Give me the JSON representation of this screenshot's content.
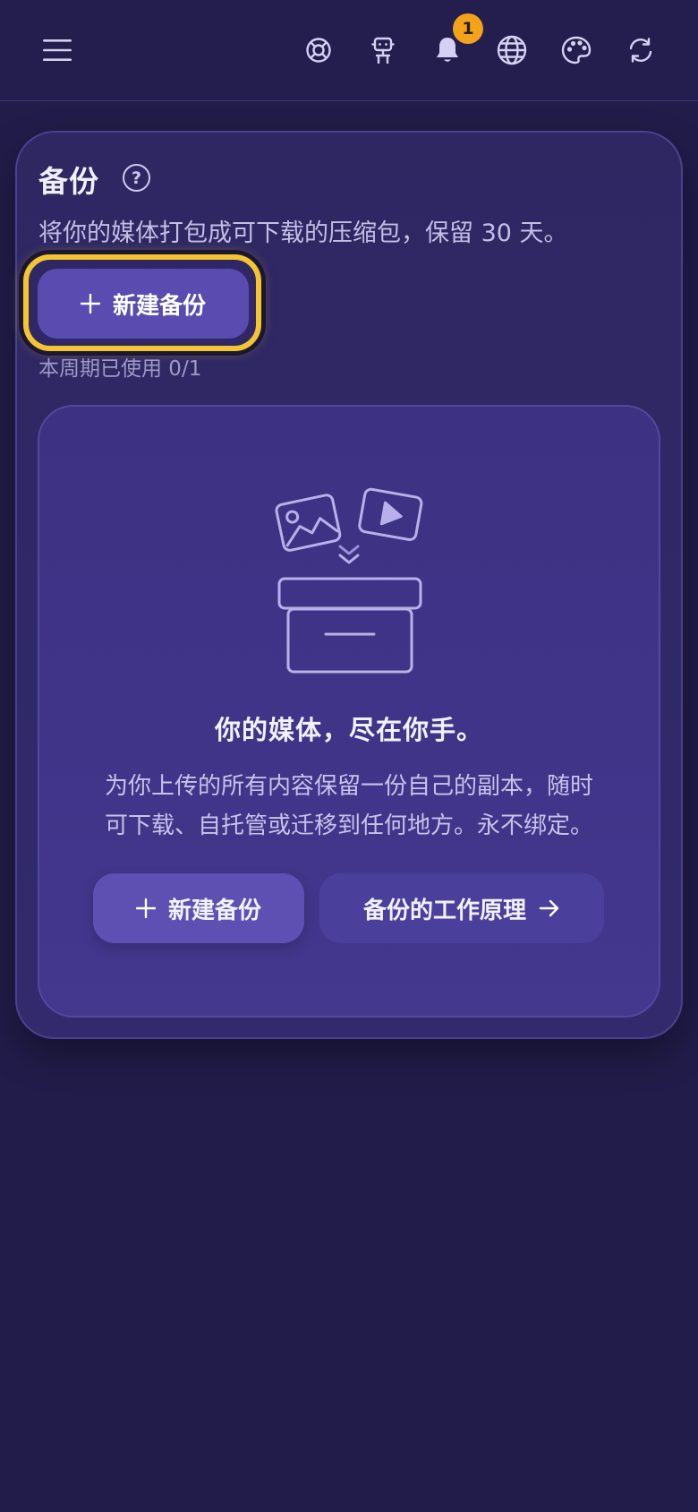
{
  "topbar": {
    "notification_count": "1",
    "icons": [
      "menu-icon",
      "lifebuoy-icon",
      "robot-icon",
      "bell-icon",
      "globe-icon",
      "palette-icon",
      "refresh-icon"
    ]
  },
  "backup": {
    "title": "备份",
    "help_glyph": "?",
    "subtitle": "将你的媒体打包成可下载的压缩包，保留 30 天。",
    "new_backup_label": "新建备份",
    "usage": "本周期已使用 0/1"
  },
  "empty_state": {
    "title": "你的媒体，尽在你手。",
    "description_line1": "为你上传的所有内容保留一份自己的副本，随时",
    "description_line2": "可下载、自托管或迁移到任何地方。永不绑定。",
    "new_backup_label": "新建备份",
    "how_it_works_label": "备份的工作原理"
  },
  "colors": {
    "background": "#221c4a",
    "card": "#2e2762",
    "accent": "#5a4bb0",
    "highlight": "#f4c531",
    "badge": "#f3a21c"
  }
}
